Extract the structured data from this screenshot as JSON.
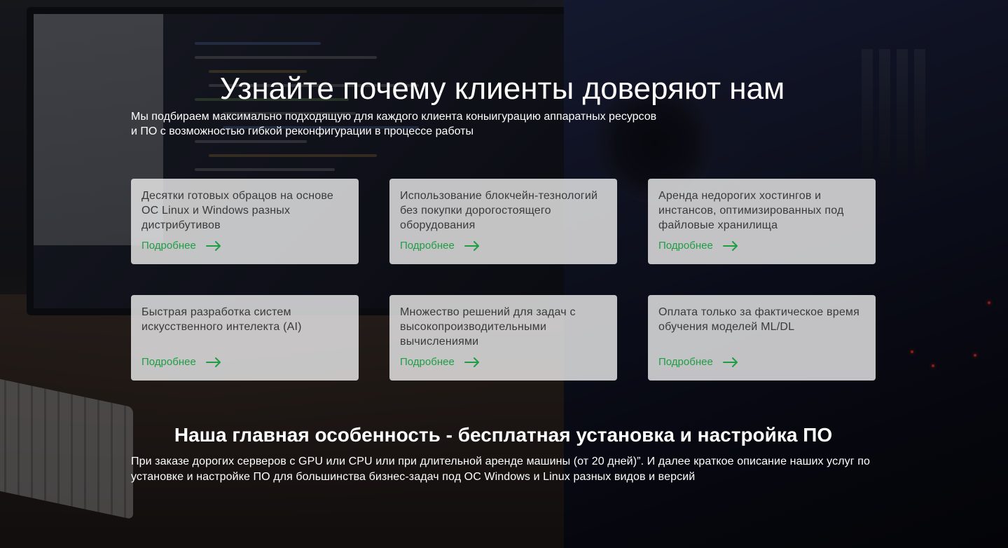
{
  "hero": {
    "title": "Узнайте почему клиенты доверяют нам",
    "subtitle_line1": "Мы подбираем максимально подходящую для каждого клиента коныигурацию аппаратных ресурсов",
    "subtitle_line2": "и ПО с возможностью гибкой реконфигурации в процессе работы"
  },
  "cards": [
    {
      "text": "Десятки готовых обрацов на основе ОС Linux и Windows разных дистрибутивов",
      "link_label": "Подробнее"
    },
    {
      "text": "Использование блокчейн-тезнологий без покупки дорогостоящего оборудования",
      "link_label": "Подробнее"
    },
    {
      "text": "Аренда недорогих хостингов и инстансов, оптимизированных под файловые хранилища",
      "link_label": "Подробнее"
    },
    {
      "text": "Быстрая разработка систем искусственного интелекта (AI)",
      "link_label": "Подробнее"
    },
    {
      "text": "Множество решений для задач с высокопроизводительными вычислениями",
      "link_label": "Подробнее"
    },
    {
      "text": "Оплата только за фактическое время обучения моделей ML/DL",
      "link_label": "Подробнее"
    }
  ],
  "feature": {
    "title": "Наша главная особенность - бесплатная установка и настройка ПО",
    "text": "При заказе дорогих серверов с GPU или CPU или при длительной аренде машины (от 20 дней)”. И далее краткое описание наших услуг по установке и настройке ПО для большинства бизнес-задач под ОС Windows и Linux разных видов и версий"
  },
  "icons": {
    "card_link_icon": "arrow-right-icon"
  },
  "colors": {
    "accent": "#1f9d45",
    "card_bg": "#ececec",
    "text_light": "#ffffff"
  }
}
